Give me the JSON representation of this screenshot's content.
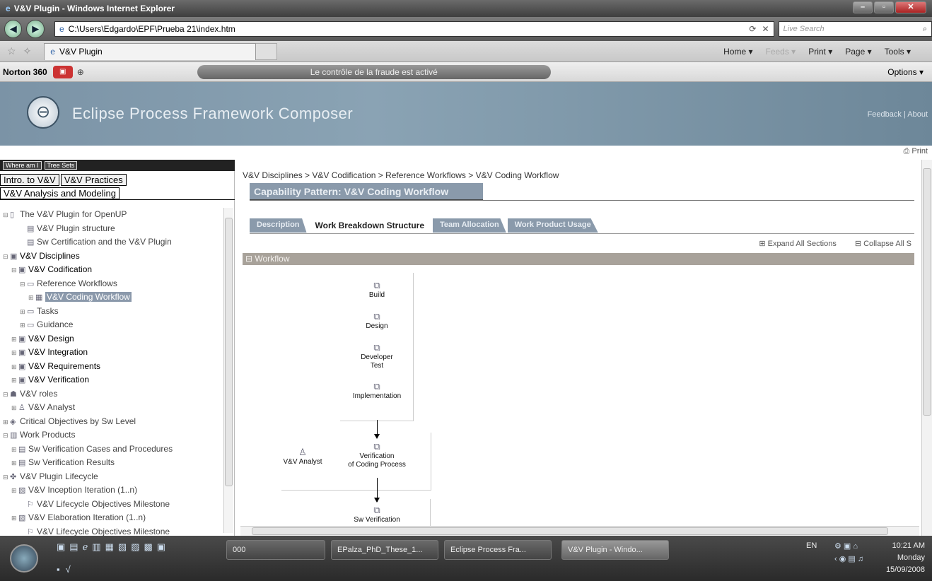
{
  "window": {
    "title": "V&V Plugin - Windows Internet Explorer",
    "min": "–",
    "max": "▫",
    "close": "✕"
  },
  "address": {
    "url": "C:\\Users\\Edgardo\\EPF\\Prueba 21\\index.htm",
    "search_placeholder": "Live Search"
  },
  "tab": {
    "label": "V&V Plugin"
  },
  "commands": {
    "home": "Home ▾",
    "feeds": "Feeds ▾",
    "print": "Print ▾",
    "page": "Page ▾",
    "tools": "Tools ▾"
  },
  "norton": {
    "label": "Norton 360",
    "fraud": "Le contrôle de la fraude est activé",
    "options": "Options ▾"
  },
  "banner": {
    "title": "Eclipse Process Framework Composer",
    "links": "Feedback | About"
  },
  "print_link": "Print",
  "left": {
    "treesets": [
      "Where am I",
      "Tree Sets"
    ],
    "tabsets": [
      "Intro. to V&V",
      "V&V Practices"
    ],
    "tabset_active": "V&V Analysis and Modeling",
    "tree": [
      {
        "label": "The V&V Plugin for OpenUP",
        "indent": 0,
        "ex": "⊟",
        "ic": "▯"
      },
      {
        "label": "V&V Plugin structure",
        "indent": 2,
        "ex": "",
        "ic": "▤"
      },
      {
        "label": "Sw Certification and the V&V Plugin",
        "indent": 2,
        "ex": "",
        "ic": "▤"
      },
      {
        "label": "V&V Disciplines",
        "indent": 0,
        "ex": "⊟",
        "ic": "▣",
        "dk": true
      },
      {
        "label": "V&V Codification",
        "indent": 1,
        "ex": "⊟",
        "ic": "▣",
        "dk": true
      },
      {
        "label": "Reference Workflows",
        "indent": 2,
        "ex": "⊟",
        "ic": "▭"
      },
      {
        "label": "V&V Coding Workflow",
        "indent": 3,
        "ex": "⊞",
        "ic": "▦",
        "sel": true
      },
      {
        "label": "Tasks",
        "indent": 2,
        "ex": "⊞",
        "ic": "▭"
      },
      {
        "label": "Guidance",
        "indent": 2,
        "ex": "⊞",
        "ic": "▭"
      },
      {
        "label": "V&V Design",
        "indent": 1,
        "ex": "⊞",
        "ic": "▣",
        "dk": true
      },
      {
        "label": "V&V Integration",
        "indent": 1,
        "ex": "⊞",
        "ic": "▣",
        "dk": true
      },
      {
        "label": "V&V Requirements",
        "indent": 1,
        "ex": "⊞",
        "ic": "▣",
        "dk": true
      },
      {
        "label": "V&V Verification",
        "indent": 1,
        "ex": "⊞",
        "ic": "▣",
        "dk": true
      },
      {
        "label": "V&V roles",
        "indent": 0,
        "ex": "⊟",
        "ic": "☗"
      },
      {
        "label": "V&V Analyst",
        "indent": 1,
        "ex": "⊞",
        "ic": "♙"
      },
      {
        "label": "Critical Objectives by Sw Level",
        "indent": 0,
        "ex": "⊞",
        "ic": "◈"
      },
      {
        "label": "Work Products",
        "indent": 0,
        "ex": "⊟",
        "ic": "▥"
      },
      {
        "label": "Sw Verification Cases and Procedures",
        "indent": 1,
        "ex": "⊞",
        "ic": "▤"
      },
      {
        "label": "Sw Verification Results",
        "indent": 1,
        "ex": "⊞",
        "ic": "▤"
      },
      {
        "label": "V&V Plugin Lifecycle",
        "indent": 0,
        "ex": "⊟",
        "ic": "✤"
      },
      {
        "label": "V&V Inception Iteration (1..n)",
        "indent": 1,
        "ex": "⊞",
        "ic": "▧"
      },
      {
        "label": "V&V Lifecycle Objectives Milestone",
        "indent": 2,
        "ex": "",
        "ic": "⚐"
      },
      {
        "label": "V&V Elaboration Iteration (1..n)",
        "indent": 1,
        "ex": "⊞",
        "ic": "▧"
      },
      {
        "label": "V&V Lifecycle Objectives Milestone",
        "indent": 2,
        "ex": "",
        "ic": "⚐"
      }
    ]
  },
  "main": {
    "breadcrumb": "V&V Disciplines > V&V Codification > Reference Workflows > V&V Coding Workflow",
    "title": "Capability Pattern: V&V Coding Workflow",
    "tabs": [
      "Description",
      "Work Breakdown Structure",
      "Team Allocation",
      "Work Product Usage"
    ],
    "active_tab": "Work Breakdown Structure",
    "expand_all": "⊞ Expand All Sections",
    "collapse_all": "⊟ Collapse All S",
    "workflow_header": "⊟ Workflow",
    "nodes": {
      "build": "Build",
      "design": "Design",
      "devtest1": "Developer",
      "devtest2": "Test",
      "impl": "Implementation",
      "analyst": "V&V Analyst",
      "verif1": "Verification",
      "verif2": "of Coding Process",
      "swverif": "Sw Verification"
    }
  },
  "taskbar": {
    "buttons": [
      "000",
      "EPalza_PhD_These_1...",
      "Eclipse Process Fra...",
      "V&V Plugin - Windo..."
    ],
    "lang": "EN",
    "time": "10:21 AM",
    "day": "Monday",
    "date": "15/09/2008"
  }
}
